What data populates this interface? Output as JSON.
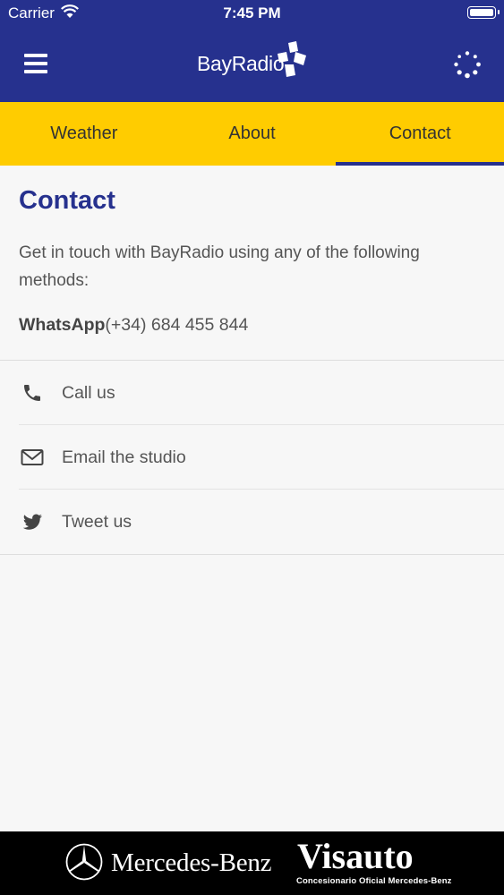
{
  "status_bar": {
    "carrier": "Carrier",
    "time": "7:45 PM"
  },
  "header": {
    "logo_text": "BayRadio",
    "background_color": "#26318e",
    "icons": [
      "hamburger-menu-icon",
      "bayradio-logo-icon",
      "loading-spinner-icon"
    ]
  },
  "tabs": [
    {
      "label": "Weather",
      "active": false
    },
    {
      "label": "About",
      "active": false
    },
    {
      "label": "Contact",
      "active": true
    }
  ],
  "tabs_background_color": "#ffcc00",
  "content": {
    "title": "Contact",
    "intro": "Get in touch with BayRadio using any of the following methods:",
    "whatsapp_label": "WhatsApp",
    "whatsapp_number": "(+34) 684 455 844"
  },
  "contact_methods": [
    {
      "label": "Call us",
      "icon": "phone-icon"
    },
    {
      "label": "Email the studio",
      "icon": "envelope-icon"
    },
    {
      "label": "Tweet us",
      "icon": "twitter-bird-icon"
    }
  ],
  "banner": {
    "brand": "Mercedes-Benz",
    "dealer": "Visauto",
    "dealer_tagline": "Concesionario Oficial Mercedes-Benz"
  }
}
